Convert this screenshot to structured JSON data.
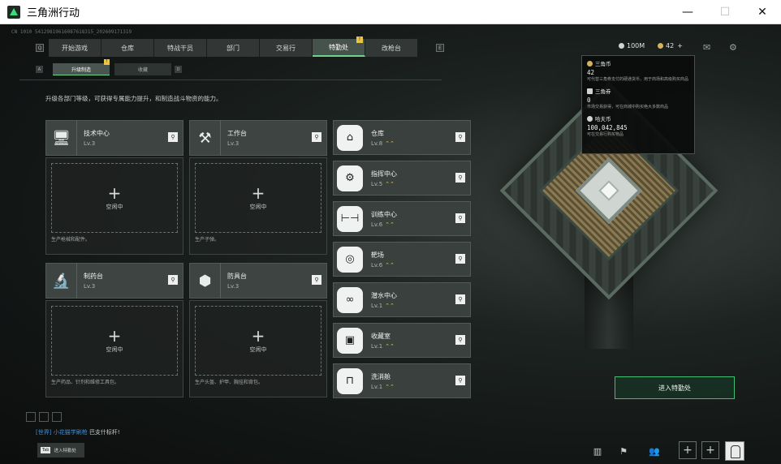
{
  "window": {
    "title": "三角洲行动",
    "controls": [
      "—",
      "☐",
      "✕"
    ]
  },
  "uid": "CN 1010 54129819616087618315_202609171319",
  "tabs": [
    {
      "label": "开始游戏",
      "active": false
    },
    {
      "label": "仓库",
      "active": false
    },
    {
      "label": "特战干员",
      "active": false
    },
    {
      "label": "部门",
      "active": false
    },
    {
      "label": "交易行",
      "active": false
    },
    {
      "label": "特勤处",
      "active": true,
      "badge": "!"
    },
    {
      "label": "改枪台",
      "active": false
    }
  ],
  "top_right": {
    "currency1": "100M",
    "currency2": "42",
    "currency2_plus": "+"
  },
  "subtabs": [
    {
      "label": "升级制造",
      "active": true,
      "badge": "!"
    },
    {
      "label": "收藏",
      "active": false
    }
  ],
  "description": "升级各部门等级，可获得专属能力提升，和制造战斗物资的能力。",
  "workbenches": [
    {
      "name": "技术中心",
      "level": "Lv.3",
      "icon": "computer-icon",
      "glyph": "🖥",
      "status": "空闲中",
      "desc": "生产枪械和配件。"
    },
    {
      "name": "工作台",
      "level": "Lv.3",
      "icon": "tools-icon",
      "glyph": "⚒",
      "status": "空闲中",
      "desc": "生产子弹。"
    },
    {
      "name": "制药台",
      "level": "Lv.3",
      "icon": "microscope-icon",
      "glyph": "🔬",
      "status": "空闲中",
      "desc": "生产药品、针剂和维修工具包。"
    },
    {
      "name": "防具台",
      "level": "Lv.3",
      "icon": "armor-boxes-icon",
      "glyph": "⬢",
      "status": "空闲中",
      "desc": "生产头盔、护甲、胸挂和背包。"
    }
  ],
  "departments": [
    {
      "name": "仓库",
      "level": "Lv.8",
      "icon": "warehouse-icon",
      "glyph": "⌂"
    },
    {
      "name": "指挥中心",
      "level": "Lv.5",
      "icon": "command-gear-icon",
      "glyph": "⚙"
    },
    {
      "name": "训练中心",
      "level": "Lv.6",
      "icon": "dumbbell-icon",
      "glyph": "⊢⊣"
    },
    {
      "name": "靶场",
      "level": "Lv.6",
      "icon": "target-icon",
      "glyph": "◎"
    },
    {
      "name": "潜水中心",
      "level": "Lv.1",
      "icon": "diving-goggles-icon",
      "glyph": "∞"
    },
    {
      "name": "收藏室",
      "level": "Lv.1",
      "icon": "collection-icon",
      "glyph": "▣"
    },
    {
      "name": "洗消舱",
      "level": "Lv.1",
      "icon": "decontamination-icon",
      "glyph": "⊓"
    }
  ],
  "upgrade_arrows": "⌃⌃",
  "search_glyph": "⚲",
  "tooltip": {
    "items": [
      {
        "name": "三角币",
        "value": "42",
        "desc": "可代替三角券支付的硬通货币，用于商场和高级购买商品",
        "color": "#d6b35a"
      },
      {
        "name": "三角券",
        "value": "0",
        "desc": "市场交易获得，可在商城中购买绝大多数商品",
        "color": "#cfd3d2"
      },
      {
        "name": "哈夫币",
        "value": "100,042,845",
        "desc": "可在交易行购买物品",
        "color": "#cfd3d2"
      }
    ]
  },
  "enter_button": "进入特勤处",
  "chat": {
    "channel": "[世界]",
    "user": "小花猫学刷枪",
    "message": "巴支什标杆!"
  },
  "enter_hint": {
    "key": "Tab",
    "label": "进入特勤处"
  },
  "colors": {
    "accent": "#6bd38a",
    "badge": "#e8c547",
    "enter_border": "#3fbf72"
  }
}
